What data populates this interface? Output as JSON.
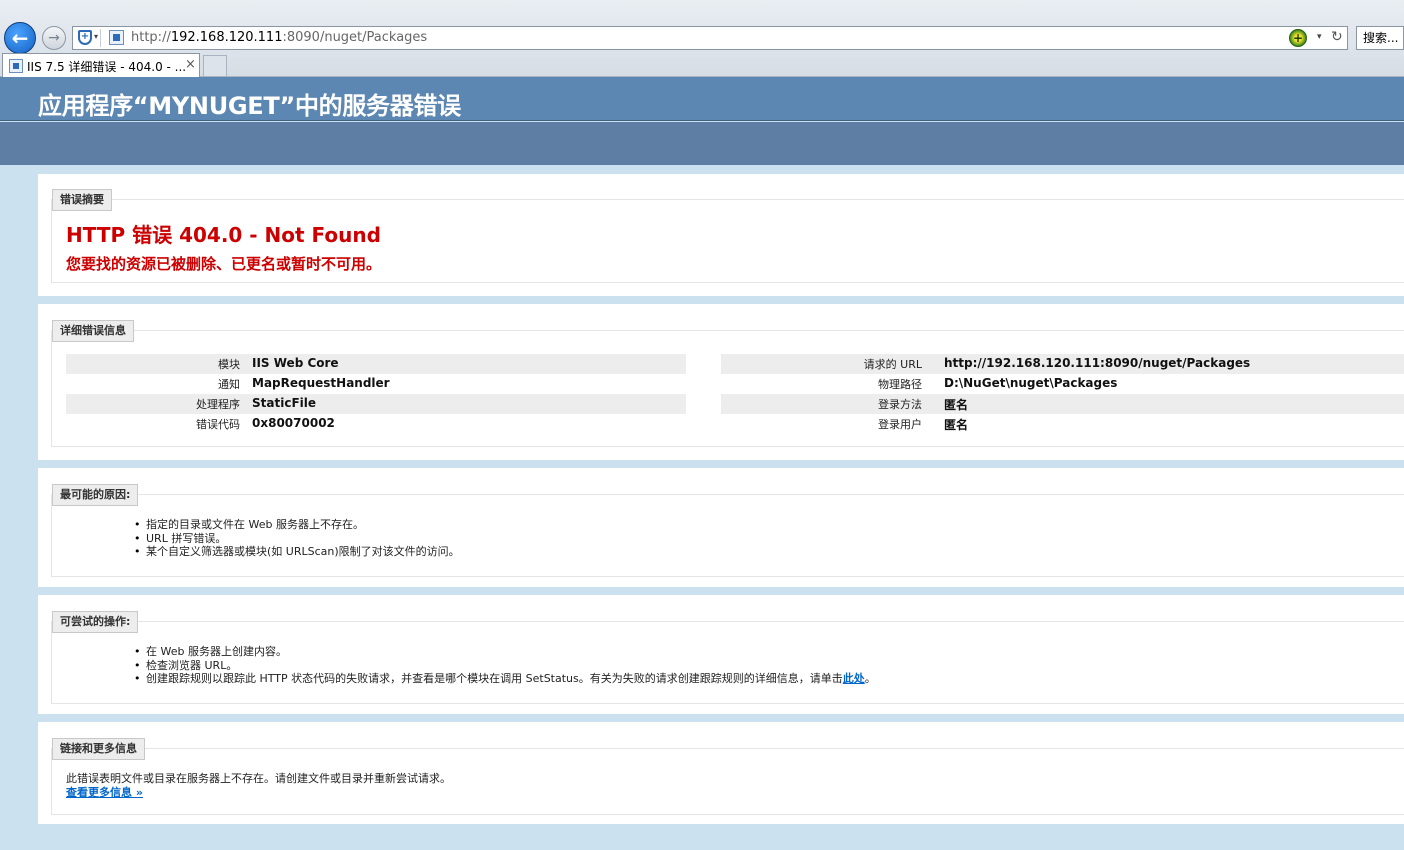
{
  "browser": {
    "url_prefix": "http://",
    "url_host": "192.168.120.111",
    "url_rest": ":8090/nuget/Packages",
    "search_label": "搜索...",
    "tab_title": "IIS 7.5 详细错误 - 404.0 - ...",
    "tab_close": "×",
    "back_glyph": "←",
    "forward_glyph": "→",
    "compat_glyph": "+",
    "refresh_glyph": "↻",
    "caret_glyph": "▾",
    "icons": [
      "back-arrow-icon",
      "forward-arrow-icon",
      "shield-icon",
      "page-icon",
      "compatibility-icon",
      "refresh-icon",
      "close-icon"
    ]
  },
  "page": {
    "title": "应用程序“MYNUGET”中的服务器错误",
    "header_color": "#5C87B2",
    "background_color": "#CBE1EF",
    "error_color": "#cc0000",
    "summary": {
      "legend": "错误摘要",
      "error_title": "HTTP 错误 404.0 - Not Found",
      "error_message": "您要找的资源已被删除、已更名或暂时不可用。"
    },
    "detail": {
      "legend": "详细错误信息",
      "left": [
        {
          "key": "模块",
          "value": "IIS Web Core"
        },
        {
          "key": "通知",
          "value": "MapRequestHandler"
        },
        {
          "key": "处理程序",
          "value": "StaticFile"
        },
        {
          "key": "错误代码",
          "value": "0x80070002"
        }
      ],
      "right": [
        {
          "key": "请求的 URL",
          "value": "http://192.168.120.111:8090/nuget/Packages"
        },
        {
          "key": "物理路径",
          "value": "D:\\NuGet\\nuget\\Packages"
        },
        {
          "key": "登录方法",
          "value": "匿名"
        },
        {
          "key": "登录用户",
          "value": "匿名"
        }
      ]
    },
    "causes": {
      "legend": "最可能的原因:",
      "items": [
        "指定的目录或文件在 Web 服务器上不存在。",
        "URL 拼写错误。",
        "某个自定义筛选器或模块(如 URLScan)限制了对该文件的访问。"
      ]
    },
    "actions": {
      "legend": "可尝试的操作:",
      "items": [
        "在 Web 服务器上创建内容。",
        "检查浏览器 URL。"
      ],
      "trace_text": "创建跟踪规则以跟踪此 HTTP 状态代码的失败请求，并查看是哪个模块在调用 SetStatus。有关为失败的请求创建跟踪规则的详细信息，请单击",
      "trace_link": "此处",
      "trace_suffix": "。"
    },
    "links": {
      "legend": "链接和更多信息",
      "text": "此错误表明文件或目录在服务器上不存在。请创建文件或目录并重新尝试请求。",
      "more": "查看更多信息 »"
    }
  }
}
